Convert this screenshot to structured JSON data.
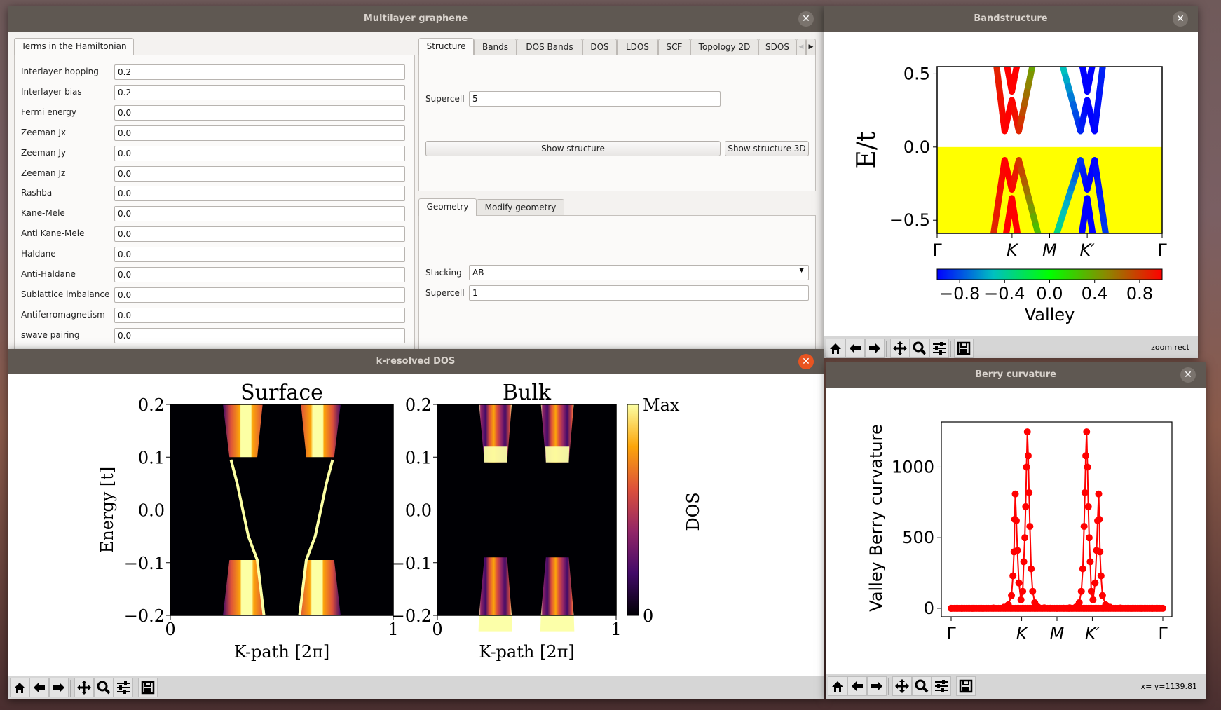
{
  "main_window": {
    "title": "Multilayer graphene",
    "close_icon": "close-icon",
    "left_tab": "Terms in the Hamiltonian",
    "params": [
      {
        "label": "Interlayer hopping",
        "value": "0.2"
      },
      {
        "label": "Interlayer bias",
        "value": "0.2"
      },
      {
        "label": "Fermi energy",
        "value": "0.0"
      },
      {
        "label": "Zeeman Jx",
        "value": "0.0"
      },
      {
        "label": "Zeeman Jy",
        "value": "0.0"
      },
      {
        "label": "Zeeman Jz",
        "value": "0.0"
      },
      {
        "label": "Rashba",
        "value": "0.0"
      },
      {
        "label": "Kane-Mele",
        "value": "0.0"
      },
      {
        "label": "Anti Kane-Mele",
        "value": "0.0"
      },
      {
        "label": "Haldane",
        "value": "0.0"
      },
      {
        "label": "Anti-Haldane",
        "value": "0.0"
      },
      {
        "label": "Sublattice imbalance",
        "value": "0.0"
      },
      {
        "label": "Antiferromagnetism",
        "value": "0.0"
      },
      {
        "label": "swave pairing",
        "value": "0.0"
      }
    ],
    "tabs": [
      "Structure",
      "Bands",
      "DOS Bands",
      "DOS",
      "LDOS",
      "SCF",
      "Topology 2D",
      "SDOS"
    ],
    "structure": {
      "supercell_label": "Supercell",
      "supercell_value": "5",
      "show_structure": "Show structure",
      "show_structure_3d": "Show structure 3D"
    },
    "geometry_tabs": [
      "Geometry",
      "Modify geometry"
    ],
    "geometry": {
      "stacking_label": "Stacking",
      "stacking_value": "AB",
      "supercell_label": "Supercell",
      "supercell_value": "1"
    }
  },
  "toolbar_icons": [
    "home-icon",
    "back-icon",
    "forward-icon",
    "pan-icon",
    "zoom-icon",
    "configure-icon",
    "save-icon"
  ],
  "band_window": {
    "title": "Bandstructure",
    "status": "zoom rect"
  },
  "dos_window": {
    "title": "k-resolved DOS"
  },
  "berry_window": {
    "title": "Berry curvature",
    "status": "x= y=1139.81"
  },
  "chart_data": [
    {
      "id": "bandstructure",
      "type": "line",
      "ylabel": "E/t",
      "ylim": [
        -0.59,
        0.55
      ],
      "yticks": [
        "0.5",
        "0.0",
        "−0.5"
      ],
      "ytick_values": [
        0.5,
        0,
        -0.5
      ],
      "xticks": [
        "Γ",
        "K",
        "M",
        "K′",
        "Γ"
      ],
      "xtick_values": [
        0,
        0.333,
        0.5,
        0.667,
        1
      ],
      "occupied_fill": {
        "from": -0.59,
        "to": 0,
        "color": "#ffff00"
      },
      "colorbar": {
        "label": "Valley",
        "range": [
          -1,
          1
        ],
        "ticks": [
          "−0.8",
          "−0.4",
          "0.0",
          "0.4",
          "0.8"
        ],
        "tick_values": [
          -0.8,
          -0.4,
          0,
          0.4,
          0.8
        ],
        "colors": [
          "#0000ff",
          "#00c0c0",
          "#00ff00",
          "#8a8a00",
          "#ff0000"
        ]
      },
      "bands": [
        {
          "points": [
            [
              0.305,
              0.6
            ],
            [
              0.332,
              0.38
            ],
            [
              0.36,
              0.6
            ]
          ],
          "valley": [
            1,
            1,
            1
          ]
        },
        {
          "points": [
            [
              0.26,
              0.6
            ],
            [
              0.3,
              0.11
            ],
            [
              0.332,
              0.32
            ],
            [
              0.363,
              0.11
            ],
            [
              0.43,
              0.6
            ]
          ],
          "valley": [
            0.85,
            1,
            1,
            0.9,
            0.35
          ]
        },
        {
          "points": [
            [
              0.25,
              -0.6
            ],
            [
              0.3,
              -0.09
            ],
            [
              0.332,
              -0.29
            ],
            [
              0.363,
              -0.09
            ],
            [
              0.45,
              -0.6
            ]
          ],
          "valley": [
            0.85,
            1,
            1,
            0.85,
            0.25
          ]
        },
        {
          "points": [
            [
              0.306,
              -0.6
            ],
            [
              0.332,
              -0.35
            ],
            [
              0.358,
              -0.6
            ]
          ],
          "valley": [
            1,
            1,
            1
          ]
        },
        {
          "points": [
            [
              0.64,
              0.6
            ],
            [
              0.667,
              0.38
            ],
            [
              0.695,
              0.6
            ]
          ],
          "valley": [
            -1,
            -1,
            -1
          ]
        },
        {
          "points": [
            [
              0.55,
              0.6
            ],
            [
              0.637,
              0.11
            ],
            [
              0.667,
              0.32
            ],
            [
              0.7,
              0.11
            ],
            [
              0.74,
              0.6
            ]
          ],
          "valley": [
            -0.4,
            -0.9,
            -1,
            -1,
            -0.9
          ]
        },
        {
          "points": [
            [
              0.53,
              -0.6
            ],
            [
              0.637,
              -0.09
            ],
            [
              0.667,
              -0.29
            ],
            [
              0.7,
              -0.09
            ],
            [
              0.75,
              -0.6
            ]
          ],
          "valley": [
            -0.3,
            -0.85,
            -1,
            -1,
            -0.85
          ]
        },
        {
          "points": [
            [
              0.642,
              -0.6
            ],
            [
              0.667,
              -0.35
            ],
            [
              0.692,
              -0.6
            ]
          ],
          "valley": [
            -1,
            -1,
            -1
          ]
        }
      ]
    },
    {
      "id": "surface-dos",
      "type": "heatmap",
      "title": "Surface",
      "xlabel": "K-path [2π]",
      "ylabel": "Energy [t]",
      "xlim": [
        0,
        1
      ],
      "ylim": [
        -0.2,
        0.2
      ],
      "xticks": [
        "0",
        "1"
      ],
      "yticks": [
        "0.2",
        "0.1",
        "0.0",
        "−0.1",
        "−0.2"
      ],
      "ytick_values": [
        0.2,
        0.1,
        0,
        -0.1,
        -0.2
      ],
      "continuum_regions": [
        [
          [
            0.236,
            0.2
          ],
          [
            0.414,
            0.2
          ],
          [
            0.39,
            0.1
          ],
          [
            0.265,
            0.1
          ]
        ],
        [
          [
            0.586,
            0.2
          ],
          [
            0.764,
            0.2
          ],
          [
            0.735,
            0.1
          ],
          [
            0.61,
            0.1
          ]
        ],
        [
          [
            0.265,
            -0.095
          ],
          [
            0.39,
            -0.095
          ],
          [
            0.42,
            -0.2
          ],
          [
            0.236,
            -0.2
          ]
        ],
        [
          [
            0.61,
            -0.095
          ],
          [
            0.735,
            -0.095
          ],
          [
            0.764,
            -0.2
          ],
          [
            0.58,
            -0.2
          ]
        ]
      ],
      "surface_states": [
        [
          [
            0.272,
            0.095
          ],
          [
            0.3,
            0.05
          ],
          [
            0.325,
            0
          ],
          [
            0.35,
            -0.05
          ],
          [
            0.39,
            -0.095
          ],
          [
            0.42,
            -0.2
          ]
        ],
        [
          [
            0.728,
            0.095
          ],
          [
            0.7,
            0.05
          ],
          [
            0.675,
            0
          ],
          [
            0.65,
            -0.05
          ],
          [
            0.61,
            -0.095
          ],
          [
            0.58,
            -0.2
          ]
        ]
      ]
    },
    {
      "id": "bulk-dos",
      "type": "heatmap",
      "title": "Bulk",
      "xlabel": "K-path [2π]",
      "xlim": [
        0,
        1
      ],
      "ylim": [
        -0.2,
        0.2
      ],
      "xticks": [
        "0",
        "1"
      ],
      "yticks": [
        "0.2",
        "0.1",
        "0.0",
        "−0.1",
        "−0.2"
      ],
      "ytick_values": [
        0.2,
        0.1,
        0,
        -0.1,
        -0.2
      ],
      "continuum_regions": [
        [
          [
            0.233,
            0.2
          ],
          [
            0.416,
            0.2
          ],
          [
            0.39,
            0.09
          ],
          [
            0.263,
            0.09
          ]
        ],
        [
          [
            0.579,
            0.2
          ],
          [
            0.763,
            0.2
          ],
          [
            0.735,
            0.09
          ],
          [
            0.607,
            0.09
          ]
        ],
        [
          [
            0.263,
            -0.09
          ],
          [
            0.39,
            -0.09
          ],
          [
            0.416,
            -0.2
          ],
          [
            0.233,
            -0.2
          ]
        ],
        [
          [
            0.607,
            -0.09
          ],
          [
            0.735,
            -0.09
          ],
          [
            0.763,
            -0.2
          ],
          [
            0.579,
            -0.2
          ]
        ]
      ],
      "colorbar": {
        "label": "DOS",
        "top": "Max",
        "bottom": "0",
        "colors": [
          "#000004",
          "#420a68",
          "#932667",
          "#dd513a",
          "#fca50a",
          "#fcffa4"
        ]
      }
    },
    {
      "id": "berry",
      "type": "line",
      "ylabel": "Valley Berry curvature",
      "color": "#ff0000",
      "ylim": [
        -60,
        1320
      ],
      "yticks": [
        "0",
        "500",
        "1000"
      ],
      "ytick_values": [
        0,
        500,
        1000
      ],
      "xticks": [
        "Γ",
        "K",
        "M",
        "K′",
        "Γ"
      ],
      "xtick_values": [
        0,
        0.333,
        0.5,
        0.667,
        1
      ],
      "x": [
        0,
        0.05,
        0.1,
        0.15,
        0.2,
        0.25,
        0.27,
        0.285,
        0.292,
        0.297,
        0.3,
        0.303,
        0.308,
        0.313,
        0.32,
        0.33,
        0.338,
        0.343,
        0.348,
        0.352,
        0.356,
        0.36,
        0.364,
        0.368,
        0.372,
        0.378,
        0.385,
        0.395,
        0.41,
        0.44,
        0.47,
        0.5,
        0.53,
        0.56,
        0.59,
        0.605,
        0.615,
        0.622,
        0.628,
        0.632,
        0.636,
        0.64,
        0.644,
        0.648,
        0.652,
        0.657,
        0.662,
        0.67,
        0.68,
        0.687,
        0.692,
        0.697,
        0.7,
        0.703,
        0.708,
        0.715,
        0.73,
        0.75,
        0.8,
        0.85,
        0.9,
        0.95,
        1
      ],
      "y": [
        0,
        0,
        0,
        0,
        2,
        8,
        25,
        90,
        230,
        400,
        630,
        810,
        620,
        410,
        180,
        60,
        120,
        330,
        500,
        720,
        1000,
        1250,
        1080,
        820,
        580,
        280,
        120,
        40,
        10,
        3,
        1,
        0,
        1,
        3,
        10,
        40,
        120,
        280,
        580,
        820,
        1080,
        1250,
        1000,
        720,
        500,
        330,
        120,
        60,
        180,
        410,
        620,
        810,
        630,
        400,
        230,
        90,
        25,
        8,
        2,
        0,
        0,
        0,
        0
      ]
    }
  ]
}
